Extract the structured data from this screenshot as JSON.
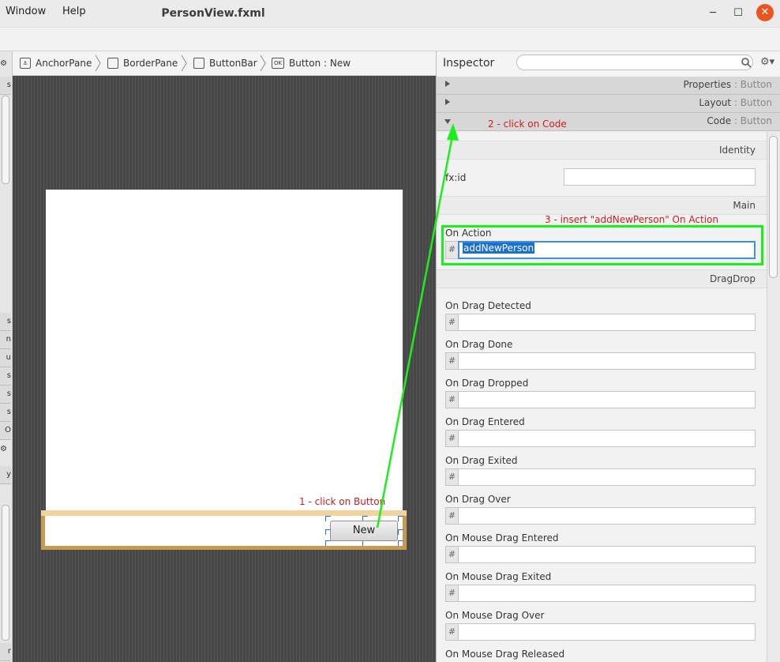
{
  "window": {
    "title": "PersonView.fxml",
    "minimize_glyph": "─",
    "maximize_glyph": "☐",
    "close_glyph": "✕"
  },
  "menubar": {
    "items": [
      "Window",
      "Help"
    ]
  },
  "left_strip": {
    "tabs": [
      "s",
      "s",
      "n",
      "u",
      "s",
      "s",
      "s",
      "O",
      "y",
      "r"
    ]
  },
  "breadcrumb": {
    "items": [
      {
        "label": "AnchorPane",
        "icon": "anchor-pane-icon"
      },
      {
        "label": "BorderPane",
        "icon": "border-pane-icon"
      },
      {
        "label": "ButtonBar",
        "icon": "button-bar-icon"
      },
      {
        "label": "Button : New",
        "icon": "button-icon",
        "icon_text": "OK"
      }
    ]
  },
  "canvas": {
    "button_label": "New",
    "bottom_text": "1 - click on Button"
  },
  "inspector": {
    "title": "Inspector",
    "search_placeholder": "",
    "sections": [
      {
        "label": "Properties",
        "suffix": "Button",
        "expanded": false
      },
      {
        "label": "Layout",
        "suffix": "Button",
        "expanded": false
      },
      {
        "label": "Code",
        "suffix": "Button",
        "expanded": true
      }
    ],
    "groups": {
      "identity": "Identity",
      "main": "Main",
      "dragdrop": "DragDrop"
    },
    "fx_id": {
      "label": "fx:id",
      "value": ""
    },
    "on_action": {
      "label": "On Action",
      "value": "addNewPerson",
      "hash": "#"
    },
    "drag_events": [
      {
        "label": "On Drag Detected",
        "value": ""
      },
      {
        "label": "On Drag Done",
        "value": ""
      },
      {
        "label": "On Drag Dropped",
        "value": ""
      },
      {
        "label": "On Drag Entered",
        "value": ""
      },
      {
        "label": "On Drag Exited",
        "value": ""
      },
      {
        "label": "On Drag Over",
        "value": ""
      },
      {
        "label": "On Mouse Drag Entered",
        "value": ""
      },
      {
        "label": "On Mouse Drag Exited",
        "value": ""
      },
      {
        "label": "On Mouse Drag Over",
        "value": ""
      },
      {
        "label": "On Mouse Drag Released",
        "value": ""
      }
    ]
  },
  "annotations": {
    "step1": "1 - click on Button",
    "step2": "2 - click on Code",
    "step3": "3 - insert \"addNewPerson\" On Action",
    "arrow_color": "#19f019",
    "text_color": "#d11b1b"
  }
}
